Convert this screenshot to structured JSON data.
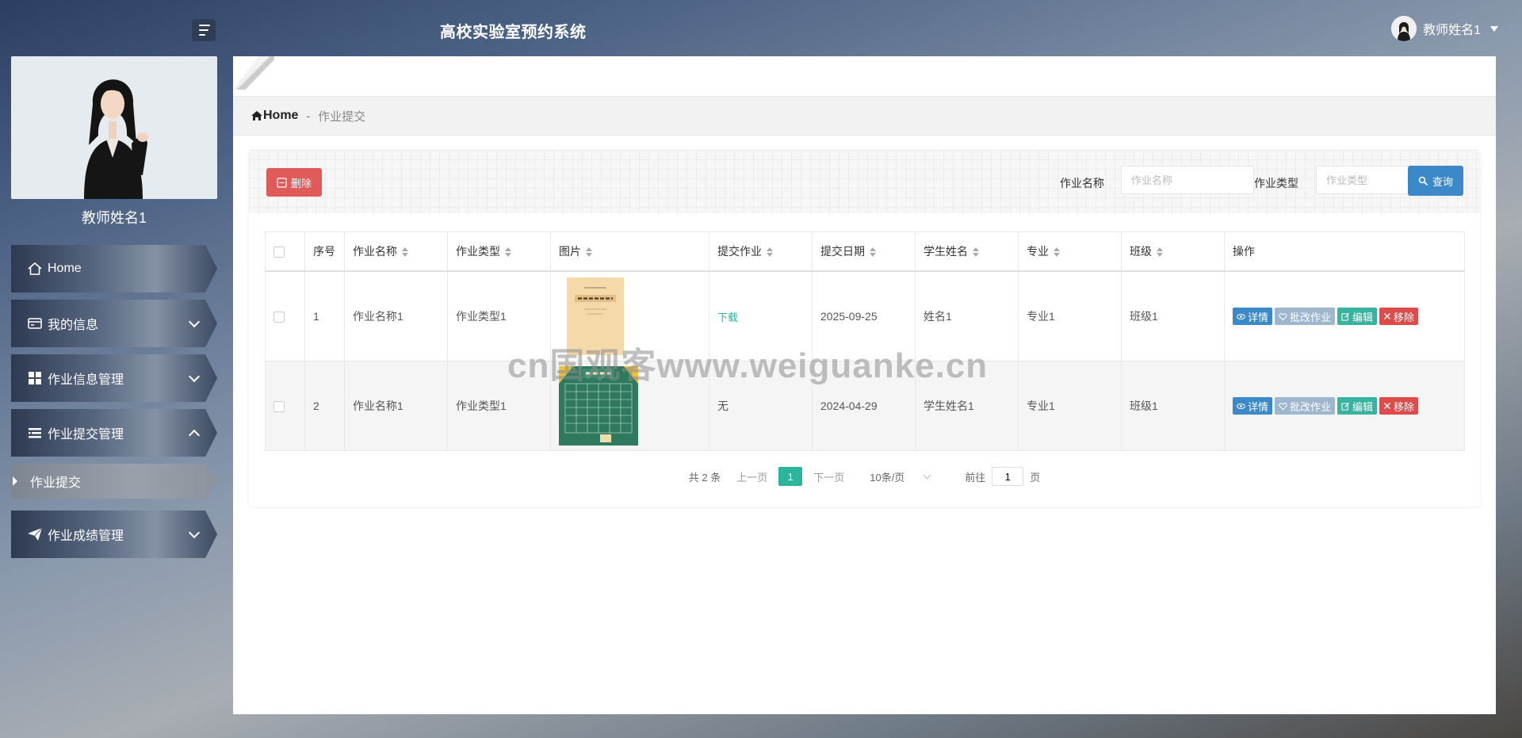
{
  "app": {
    "title": "高校实验室预约系统"
  },
  "header": {
    "user_name": "教师姓名1",
    "menu_toggle_icon": "hamburger-icon"
  },
  "sidebar": {
    "profile_name": "教师姓名1",
    "items": [
      {
        "label": "Home",
        "icon": "home-icon"
      },
      {
        "label": "我的信息",
        "icon": "id-card-icon"
      },
      {
        "label": "作业信息管理",
        "icon": "grid-icon"
      },
      {
        "label": "作业提交管理",
        "icon": "list-icon",
        "expanded": true
      },
      {
        "label": "作业成绩管理",
        "icon": "paper-plane-icon"
      }
    ],
    "sub_items": [
      {
        "label": "作业提交",
        "active": true
      }
    ]
  },
  "breadcrumb": {
    "home": "Home",
    "separator": "-",
    "current": "作业提交"
  },
  "toolbar": {
    "delete_label": "删除",
    "search": [
      {
        "label": "作业名称",
        "placeholder": "作业名称"
      },
      {
        "label": "作业类型",
        "placeholder": "作业类型"
      }
    ],
    "search_button": "查询"
  },
  "table": {
    "columns": [
      "序号",
      "作业名称",
      "作业类型",
      "图片",
      "提交作业",
      "提交日期",
      "学生姓名",
      "专业",
      "班级",
      "操作"
    ],
    "rows": [
      {
        "index": "1",
        "name": "作业名称1",
        "type": "作业类型1",
        "image": "book-cover",
        "submission": "下载",
        "date": "2025-09-25",
        "student": "姓名1",
        "major": "专业1",
        "class": "班级1"
      },
      {
        "index": "2",
        "name": "作业名称1",
        "type": "作业类型1",
        "image": "timetable",
        "submission": "无",
        "date": "2024-04-29",
        "student": "学生姓名1",
        "major": "专业1",
        "class": "班级1"
      }
    ],
    "actions": {
      "detail": "详情",
      "grade": "批改作业",
      "edit": "编辑",
      "remove": "移除"
    }
  },
  "pagination": {
    "total": "共 2 条",
    "prev": "上一页",
    "current_page": "1",
    "next": "下一页",
    "page_size": "10条/页",
    "goto_label": "前往",
    "goto_value": "1",
    "goto_suffix": "页"
  },
  "watermark": "cn国观客www.weiguanke.cn",
  "colors": {
    "accent": "#2cb59b",
    "danger": "#e05a5a",
    "primary": "#3b89c9",
    "grade": "#9fb6cf",
    "edit": "#37b3a0",
    "remove": "#dd4b4b"
  }
}
